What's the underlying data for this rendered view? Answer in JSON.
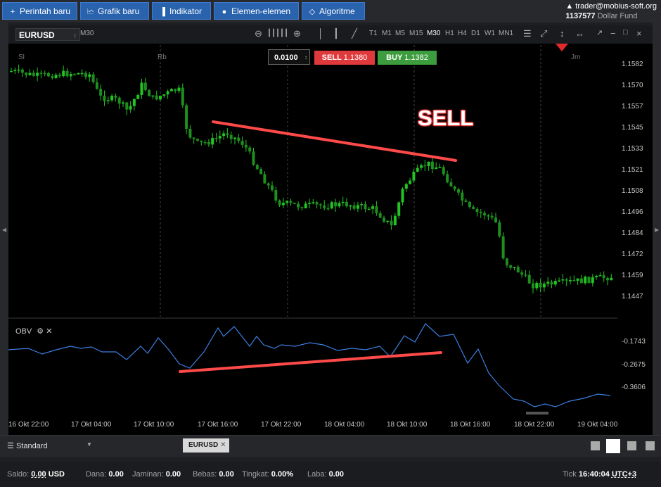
{
  "topbar": {
    "buttons": [
      {
        "label": "Perintah baru",
        "icon": "plus-icon"
      },
      {
        "label": "Grafik baru",
        "icon": "chart-icon"
      },
      {
        "label": "Indikator",
        "icon": "bars-icon"
      },
      {
        "label": "Elemen-elemen",
        "icon": "shapes-icon"
      },
      {
        "label": "Algoritme",
        "icon": "diamond-icon"
      }
    ],
    "user_email": "trader@mobius-soft.org",
    "account_id": "1137577",
    "account_name": "Dollar Fund"
  },
  "toolbar": {
    "symbol": "EURUSD",
    "chart_timeframe": "M30",
    "timeframes": [
      "T1",
      "M1",
      "M5",
      "M15",
      "M30",
      "H1",
      "H4",
      "D1",
      "W1",
      "MN1"
    ],
    "active_timeframe": "M30"
  },
  "trade_panel": {
    "quantity": "0.0100",
    "sell_label": "SELL",
    "sell_price": "1.1380",
    "buy_label": "BUY",
    "buy_price": "1.1382"
  },
  "annotation_text": "SELL",
  "chart": {
    "day_markers": [
      "Sl",
      "Rb",
      "Jm"
    ],
    "price_ticks": [
      "1.1582",
      "1.1570",
      "1.1557",
      "1.1545",
      "1.1533",
      "1.1521",
      "1.1508",
      "1.1496",
      "1.1484",
      "1.1472",
      "1.1459",
      "1.1447"
    ],
    "obv_label": "OBV",
    "obv_ticks": [
      "-0.1743",
      "-0.2675",
      "-0.3606"
    ],
    "time_ticks": [
      "16 Okt 22:00",
      "17 Okt 04:00",
      "17 Okt 10:00",
      "17 Okt 16:00",
      "17 Okt 22:00",
      "18 Okt 04:00",
      "18 Okt 10:00",
      "18 Okt 16:00",
      "18 Okt 22:00",
      "19 Okt 04:00"
    ]
  },
  "bottom": {
    "layout_label": "Standard",
    "tab_label": "EURUSD"
  },
  "status": {
    "saldo_label": "Saldo:",
    "saldo_value": "0.00",
    "currency": "USD",
    "dana_label": "Dana:",
    "dana_value": "0.00",
    "jaminan_label": "Jaminan:",
    "jaminan_value": "0.00",
    "bebas_label": "Bebas:",
    "bebas_value": "0.00",
    "tingkat_label": "Tingkat:",
    "tingkat_value": "0.00%",
    "laba_label": "Laba:",
    "laba_value": "0.00",
    "tick_label": "Tick",
    "time": "16:40:04",
    "timezone": "UTC+3"
  },
  "colors": {
    "bull": "#22c322",
    "bear": "#1e8f1e",
    "obv_line": "#3b7fe0",
    "trendline": "#ff4a4a",
    "sell": "#e0393b",
    "buy": "#3d9c3d"
  }
}
